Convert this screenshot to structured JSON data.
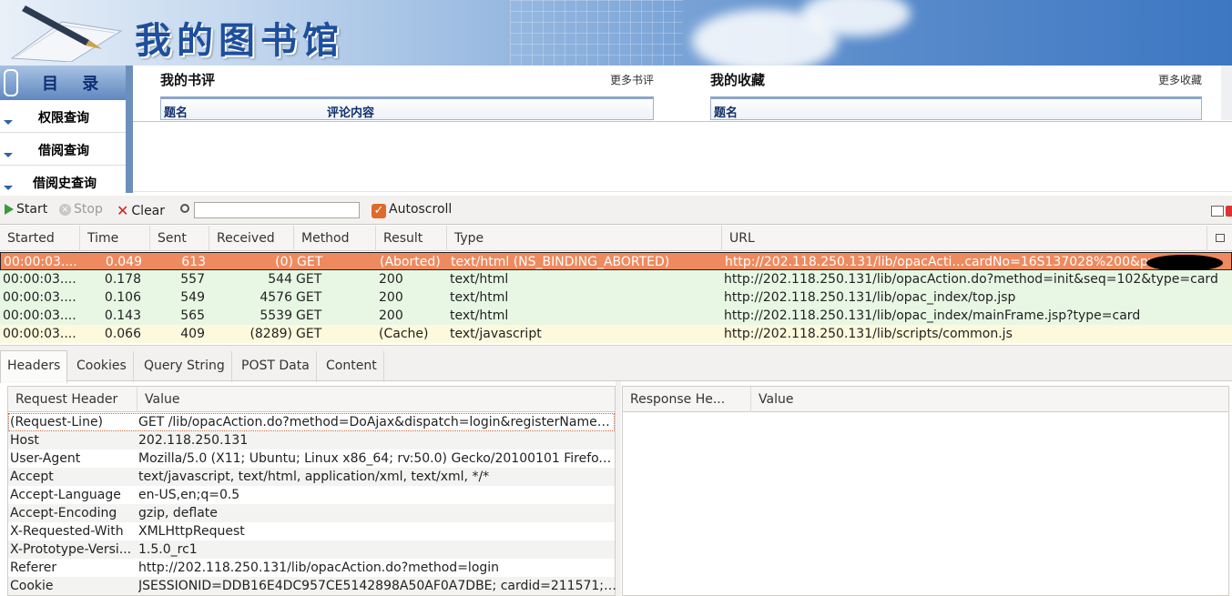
{
  "banner": {
    "title": "我的图书馆"
  },
  "nav": {
    "heading": "目 录",
    "items": [
      {
        "label": "权限查询"
      },
      {
        "label": "借阅查询"
      },
      {
        "label": "借阅史查询"
      }
    ]
  },
  "reviews": {
    "title": "我的书评",
    "more": "更多书评",
    "col1": "题名",
    "col2": "评论内容"
  },
  "favorites": {
    "title": "我的收藏",
    "more": "更多收藏",
    "col1": "题名"
  },
  "toolbar": {
    "start": "Start",
    "stop": "Stop",
    "clear": "Clear",
    "search_value": "",
    "autoscroll": "Autoscroll",
    "autoscroll_checked": true
  },
  "requests": {
    "columns": [
      "Started",
      "Time",
      "Sent",
      "Received",
      "Method",
      "Result",
      "Type",
      "URL"
    ],
    "rows": [
      {
        "started": "00:00:03....",
        "time": "0.049",
        "sent": "613",
        "received": "(0)",
        "method": "GET",
        "result": "(Aborted)",
        "type": "text/html (NS_BINDING_ABORTED)",
        "url": "http://202.118.250.131/lib/opacActi…cardNo=16S137028%200&pwd=",
        "state": "selected"
      },
      {
        "started": "00:00:03....",
        "time": "0.178",
        "sent": "557",
        "received": "544",
        "method": "GET",
        "result": "200",
        "type": "text/html",
        "url": "http://202.118.250.131/lib/opacAction.do?method=init&seq=102&type=card",
        "state": "ok"
      },
      {
        "started": "00:00:03....",
        "time": "0.106",
        "sent": "549",
        "received": "4576",
        "method": "GET",
        "result": "200",
        "type": "text/html",
        "url": "http://202.118.250.131/lib/opac_index/top.jsp",
        "state": "ok"
      },
      {
        "started": "00:00:03....",
        "time": "0.143",
        "sent": "565",
        "received": "5539",
        "method": "GET",
        "result": "200",
        "type": "text/html",
        "url": "http://202.118.250.131/lib/opac_index/mainFrame.jsp?type=card",
        "state": "ok"
      },
      {
        "started": "00:00:03....",
        "time": "0.066",
        "sent": "409",
        "received": "(8289)",
        "method": "GET",
        "result": "(Cache)",
        "type": "text/javascript",
        "url": "http://202.118.250.131/lib/scripts/common.js",
        "state": "cache"
      }
    ]
  },
  "detail_tabs": [
    "Headers",
    "Cookies",
    "Query String",
    "POST Data",
    "Content"
  ],
  "request_headers": {
    "col_name": "Request Header",
    "col_value": "Value",
    "rows": [
      {
        "k": "(Request-Line)",
        "v": "GET /lib/opacAction.do?method=DoAjax&dispatch=login&registerName=..."
      },
      {
        "k": "Host",
        "v": "202.118.250.131"
      },
      {
        "k": "User-Agent",
        "v": "Mozilla/5.0 (X11; Ubuntu; Linux x86_64; rv:50.0) Gecko/20100101 Firefox/5..."
      },
      {
        "k": "Accept",
        "v": "text/javascript, text/html, application/xml, text/xml, */*"
      },
      {
        "k": "Accept-Language",
        "v": "en-US,en;q=0.5"
      },
      {
        "k": "Accept-Encoding",
        "v": "gzip, deflate"
      },
      {
        "k": "X-Requested-With",
        "v": "XMLHttpRequest"
      },
      {
        "k": "X-Prototype-Versi...",
        "v": "1.5.0_rc1"
      },
      {
        "k": "Referer",
        "v": "http://202.118.250.131/lib/opacAction.do?method=login"
      },
      {
        "k": "Cookie",
        "v": "JSESSIONID=DDB16E4DC957CE5142898A50AF0A7DBE; cardid=211571; ca..."
      }
    ]
  },
  "response_headers": {
    "col_name": "Response He...",
    "col_value": "Value"
  },
  "colors": {
    "selected_row": "#ee8a5f",
    "ok_row": "#e8f7e4",
    "cache_row": "#fcf9dd",
    "banner_title": "#1d4f9e"
  }
}
